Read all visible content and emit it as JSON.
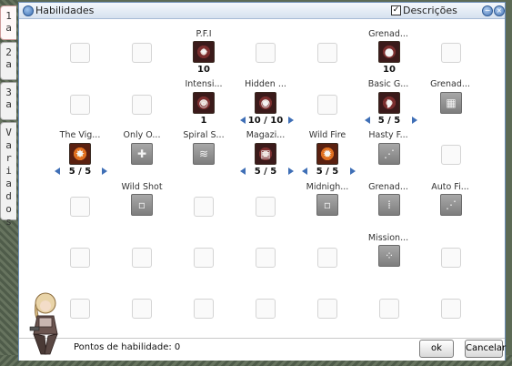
{
  "window": {
    "title": "Habilidades",
    "show_descriptions_label": "Descrições",
    "show_descriptions_checked": true
  },
  "tabs": [
    {
      "label": "1a",
      "active": true
    },
    {
      "label": "2a",
      "active": false
    },
    {
      "label": "3a",
      "active": false
    },
    {
      "label": "Variados",
      "active": false
    }
  ],
  "skills": {
    "pfi": {
      "name": "P.F.I",
      "level": "10",
      "icon": "pfi-skill-icon"
    },
    "grenad_top": {
      "name": "Grenad...",
      "level": "10",
      "icon": "grenade-skill-icon"
    },
    "intensi": {
      "name": "Intensi...",
      "level": "1",
      "icon": "intensify-skill-icon"
    },
    "hidden": {
      "name": "Hidden ...",
      "level": "10 / 10",
      "icon": "hidden-skill-icon"
    },
    "basic_g": {
      "name": "Basic G...",
      "level": "5 / 5",
      "icon": "basic-grenade-skill-icon"
    },
    "grenad_r2": {
      "name": "Grenad...",
      "icon": "grenade-locked-icon"
    },
    "the_vig": {
      "name": "The Vig...",
      "level": "5 / 5",
      "icon": "vigilante-skill-icon"
    },
    "only_o": {
      "name": "Only O...",
      "icon": "only-one-locked-icon"
    },
    "spiral_s": {
      "name": "Spiral S...",
      "icon": "spiral-shot-locked-icon"
    },
    "magazi": {
      "name": "Magazi...",
      "level": "5 / 5",
      "icon": "magazine-skill-icon"
    },
    "wild_fire": {
      "name": "Wild Fire",
      "level": "5 / 5",
      "icon": "wild-fire-skill-icon"
    },
    "hasty_f": {
      "name": "Hasty F...",
      "icon": "hasty-fire-locked-icon"
    },
    "wild_shot": {
      "name": "Wild Shot",
      "icon": "wild-shot-locked-icon"
    },
    "midnigh": {
      "name": "Midnigh...",
      "icon": "midnight-locked-icon"
    },
    "grenad_r4": {
      "name": "Grenad...",
      "icon": "grenade-locked-icon"
    },
    "auto_fi": {
      "name": "Auto Fi...",
      "icon": "auto-fire-locked-icon"
    },
    "mission": {
      "name": "Mission...",
      "icon": "mission-locked-icon"
    }
  },
  "footer": {
    "skill_points": "Pontos de habilidade: 0",
    "ok_label": "ok",
    "cancel_label": "Cancelar"
  }
}
